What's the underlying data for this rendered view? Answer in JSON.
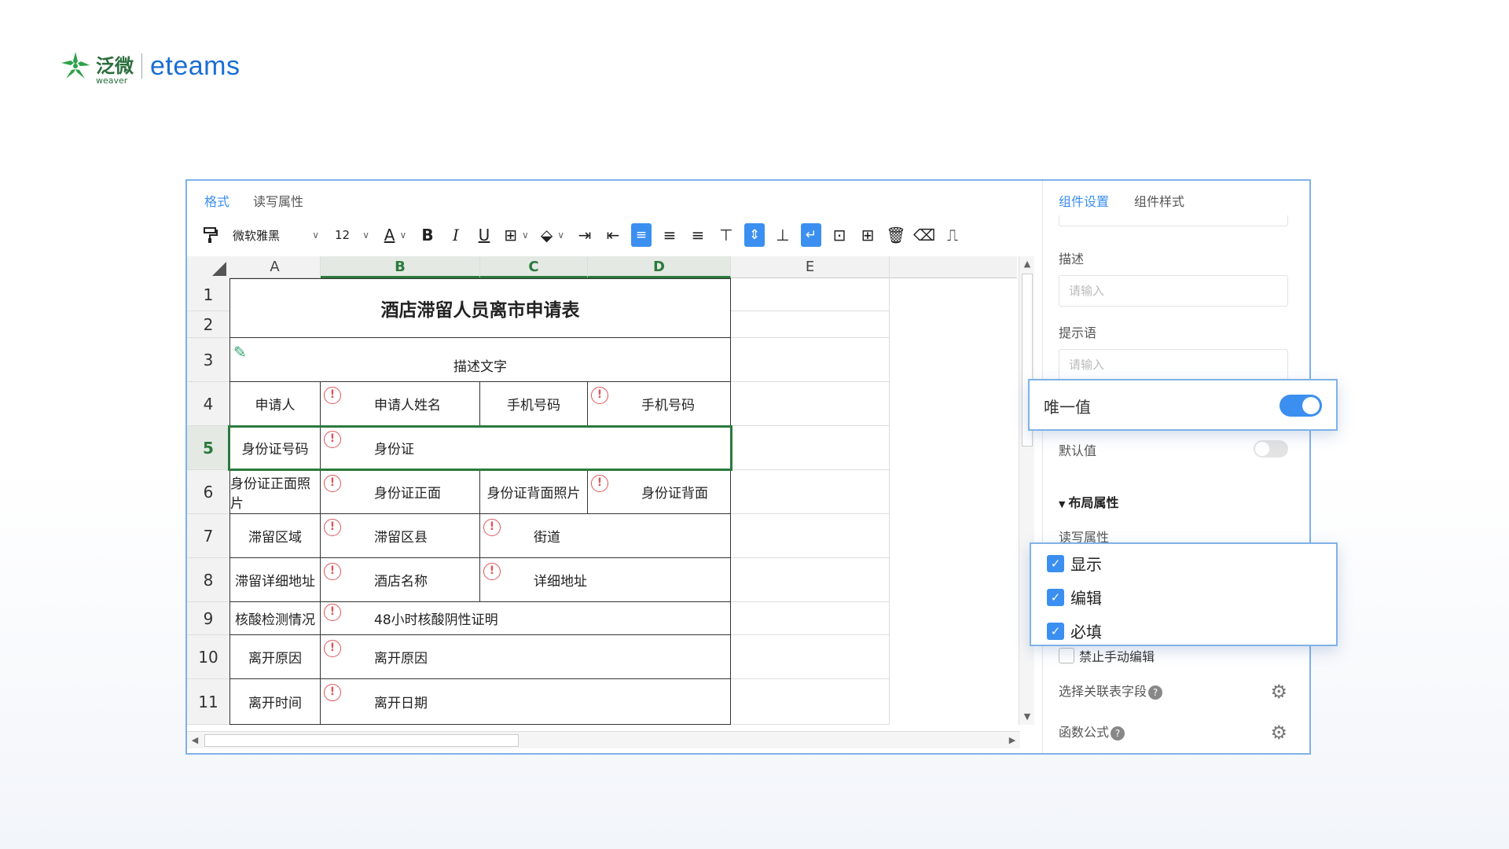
{
  "brand": {
    "cn": "泛微",
    "en_small": "weaver",
    "product": "eteams"
  },
  "left_tabs": [
    {
      "label": "格式",
      "active": true
    },
    {
      "label": "读写属性",
      "active": false
    }
  ],
  "toolbar": {
    "font_family": "微软雅黑",
    "font_size": "12",
    "icons": [
      "format-painter-icon",
      "font-color-icon",
      "bold-icon",
      "italic-icon",
      "underline-icon",
      "border-icon",
      "fill-color-icon",
      "indent-icon",
      "outdent-icon",
      "align-left-icon",
      "align-center-icon",
      "align-right-icon",
      "valign-top-icon",
      "valign-middle-icon",
      "valign-bottom-icon",
      "wrap-text-icon",
      "merge-icon",
      "unmerge-icon",
      "delete-icon",
      "clear-icon",
      "stamp-icon"
    ],
    "bold": "B",
    "italic": "I",
    "underline": "U",
    "font_color": "A"
  },
  "sheet": {
    "columns": [
      "A",
      "B",
      "C",
      "D",
      "E"
    ],
    "active_columns": [
      "B",
      "C",
      "D"
    ],
    "rows": [
      "1",
      "2",
      "3",
      "4",
      "5",
      "6",
      "7",
      "8",
      "9",
      "10",
      "11"
    ],
    "active_row": "5",
    "title": "酒店滞留人员离市申请表",
    "desc": "描述文字",
    "cells": {
      "r4": {
        "a": "申请人",
        "b": "申请人姓名",
        "c": "手机号码",
        "d": "手机号码"
      },
      "r5": {
        "a": "身份证号码",
        "b": "身份证"
      },
      "r6": {
        "a": "身份证正面照片",
        "b": "身份证正面",
        "c": "身份证背面照片",
        "d": "身份证背面"
      },
      "r7": {
        "a": "滞留区域",
        "b": "滞留区县",
        "c": "街道"
      },
      "r8": {
        "a": "滞留详细地址",
        "b": "酒店名称",
        "c": "详细地址"
      },
      "r9": {
        "a": "核酸检测情况",
        "b": "48小时核酸阴性证明"
      },
      "r10": {
        "a": "离开原因",
        "b": "离开原因"
      },
      "r11": {
        "a": "离开时间",
        "b": "离开日期"
      }
    },
    "warn_glyph": "!"
  },
  "right_tabs": [
    {
      "label": "组件设置",
      "active": true
    },
    {
      "label": "组件样式",
      "active": false
    }
  ],
  "settings": {
    "desc_label": "描述",
    "desc_placeholder": "请输入",
    "hint_label": "提示语",
    "hint_placeholder": "请输入",
    "unique_label": "唯一值",
    "unique_on": true,
    "default_label": "默认值",
    "default_on": false,
    "layout_section": "布局属性",
    "rw_label": "读写属性",
    "checks": [
      {
        "label": "显示",
        "checked": true
      },
      {
        "label": "编辑",
        "checked": true
      },
      {
        "label": "必填",
        "checked": true
      }
    ],
    "no_manual_edit": {
      "label": "禁止手动编辑",
      "checked": false
    },
    "linked_field_label": "选择关联表字段",
    "formula_label": "函数公式",
    "help_glyph": "?"
  },
  "colors": {
    "accent": "#3b8ff0",
    "active_green": "#2b7a3d",
    "warn": "#e0555a",
    "frame": "#7fb2e8"
  }
}
